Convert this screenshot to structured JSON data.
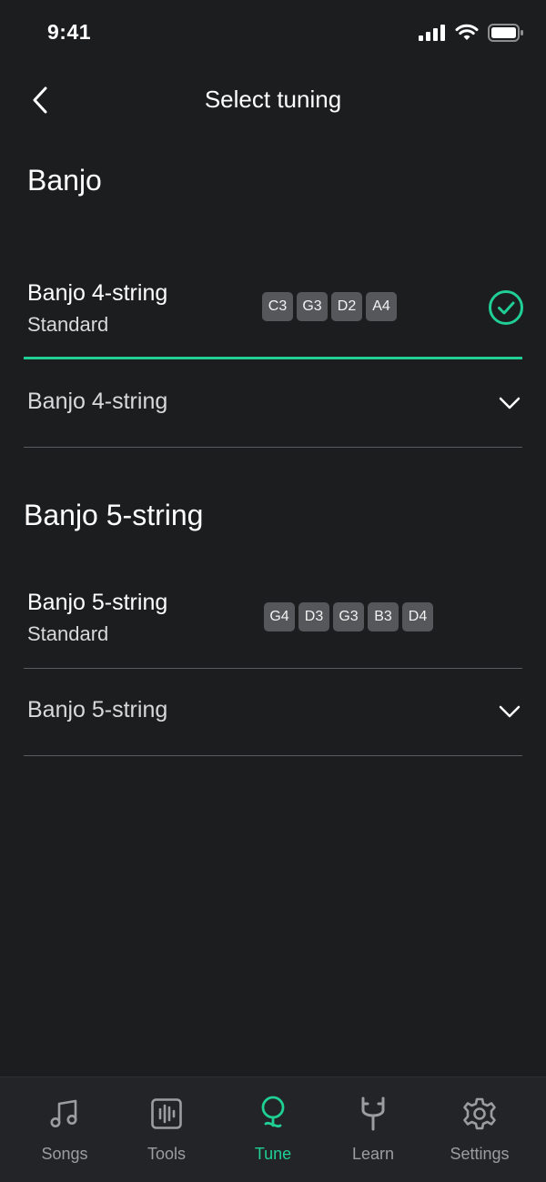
{
  "status_bar": {
    "time": "9:41"
  },
  "nav": {
    "title": "Select tuning"
  },
  "sections": [
    {
      "heading": "Banjo",
      "selected": {
        "title": "Banjo 4-string",
        "subtitle": "Standard",
        "notes": [
          "C3",
          "G3",
          "D2",
          "A4"
        ]
      },
      "expandable": {
        "label": "Banjo 4-string"
      }
    },
    {
      "heading": "Banjo 5-string",
      "selected": {
        "title": "Banjo 5-string",
        "subtitle": "Standard",
        "notes": [
          "G4",
          "D3",
          "G3",
          "B3",
          "D4"
        ]
      },
      "expandable": {
        "label": "Banjo 5-string"
      }
    }
  ],
  "tab_bar": {
    "tabs": [
      {
        "label": "Songs",
        "icon": "music-note-icon"
      },
      {
        "label": "Tools",
        "icon": "waveform-icon"
      },
      {
        "label": "Tune",
        "icon": "tuning-peg-icon"
      },
      {
        "label": "Learn",
        "icon": "fork-icon"
      },
      {
        "label": "Settings",
        "icon": "gear-icon"
      }
    ],
    "active_tab": "Tune"
  },
  "colors": {
    "background": "#1c1d1f",
    "accent": "#1fcf93",
    "chip": "#56575b",
    "tab_bar": "#232427"
  }
}
